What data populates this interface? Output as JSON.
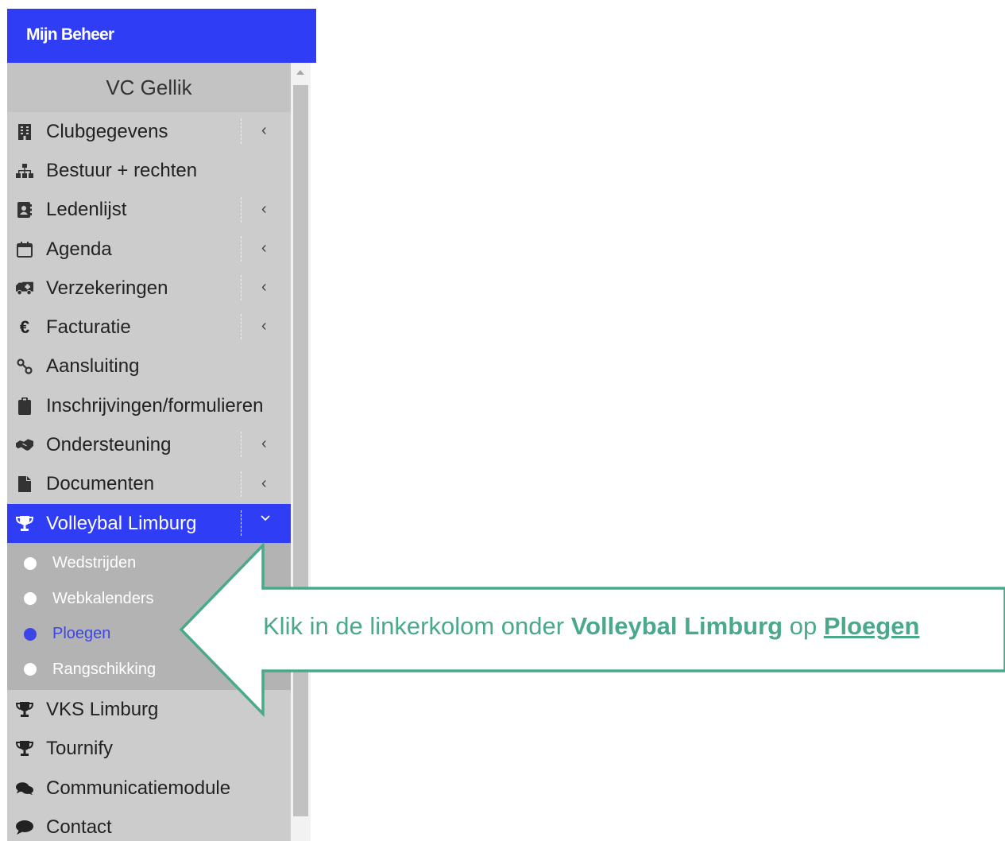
{
  "app": {
    "title": "Mijn Beheer"
  },
  "club": {
    "name": "VC Gellik"
  },
  "menu": [
    {
      "label": "Clubgegevens",
      "icon": "building-icon",
      "expandable": true
    },
    {
      "label": "Bestuur + rechten",
      "icon": "sitemap-icon",
      "expandable": false
    },
    {
      "label": "Ledenlijst",
      "icon": "address-book-icon",
      "expandable": true
    },
    {
      "label": "Agenda",
      "icon": "calendar-icon",
      "expandable": true
    },
    {
      "label": "Verzekeringen",
      "icon": "ambulance-icon",
      "expandable": true
    },
    {
      "label": "Facturatie",
      "icon": "euro-icon",
      "expandable": true
    },
    {
      "label": "Aansluiting",
      "icon": "percent-link-icon",
      "expandable": false
    },
    {
      "label": "Inschrijvingen/formulieren",
      "icon": "clipboard-icon",
      "expandable": false
    },
    {
      "label": "Ondersteuning",
      "icon": "handshake-icon",
      "expandable": true
    },
    {
      "label": "Documenten",
      "icon": "file-icon",
      "expandable": true
    },
    {
      "label": "Volleybal Limburg",
      "icon": "trophy-icon",
      "expandable": true,
      "active": true
    }
  ],
  "submenu": [
    {
      "label": "Wedstrijden"
    },
    {
      "label": "Webkalenders"
    },
    {
      "label": "Ploegen",
      "current": true
    },
    {
      "label": "Rangschikking"
    }
  ],
  "menu_after": [
    {
      "label": "VKS Limburg",
      "icon": "trophy-icon"
    },
    {
      "label": "Tournify",
      "icon": "trophy-icon"
    },
    {
      "label": "Communicatiemodule",
      "icon": "comments-icon"
    },
    {
      "label": "Contact",
      "icon": "comment-icon"
    }
  ],
  "callout": {
    "text_before": "Klik in de linkerkolom onder ",
    "bold": "Volleybal Limburg",
    "text_middle": " op ",
    "link": "Ploegen",
    "color": "#4aa88b"
  },
  "colors": {
    "accent": "#2f3df5",
    "sidebar": "#cccccc",
    "submenu": "#b3b3b3"
  }
}
